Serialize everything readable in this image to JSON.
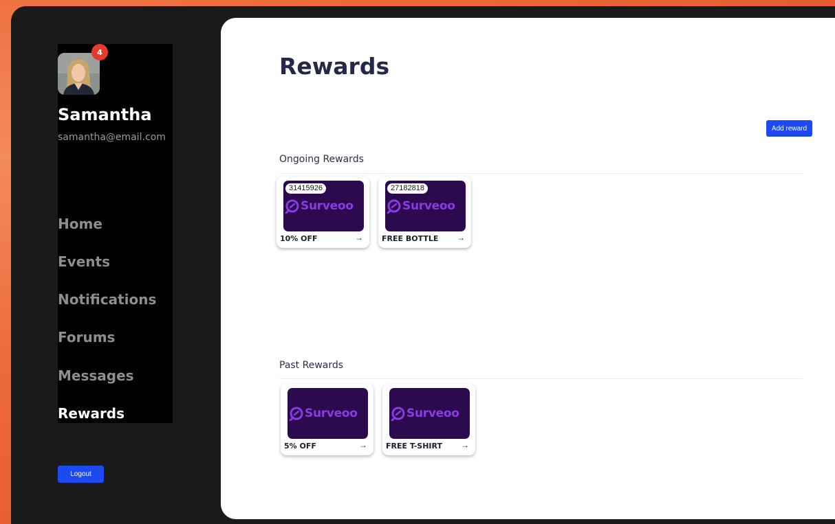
{
  "user": {
    "name": "Samantha",
    "email": "samantha@email.com",
    "notification_count": "4"
  },
  "nav": {
    "items": [
      {
        "label": "Home"
      },
      {
        "label": "Events"
      },
      {
        "label": "Notifications"
      },
      {
        "label": "Forums"
      },
      {
        "label": "Messages"
      },
      {
        "label": "Rewards",
        "active": true
      }
    ],
    "logout_label": "Logout"
  },
  "page": {
    "title": "Rewards",
    "add_reward_label": "Add reward"
  },
  "sections": {
    "ongoing": {
      "title": "Ongoing Rewards",
      "cards": [
        {
          "code": "31415926",
          "brand": "Surveoo",
          "label": "10% OFF",
          "arrow": "→"
        },
        {
          "code": "27182818",
          "brand": "Surveoo",
          "label": "FREE BOTTLE",
          "arrow": "→"
        }
      ]
    },
    "past": {
      "title": "Past Rewards",
      "cards": [
        {
          "brand": "Surveoo",
          "label": "5% OFF",
          "arrow": "→"
        },
        {
          "brand": "Surveoo",
          "label": "FREE T-SHIRT",
          "arrow": "→"
        }
      ]
    }
  },
  "colors": {
    "accent": "#1c49f0",
    "card_background": "#2c0a4e",
    "brand": "#8b3be3",
    "badge": "#e23b30"
  }
}
